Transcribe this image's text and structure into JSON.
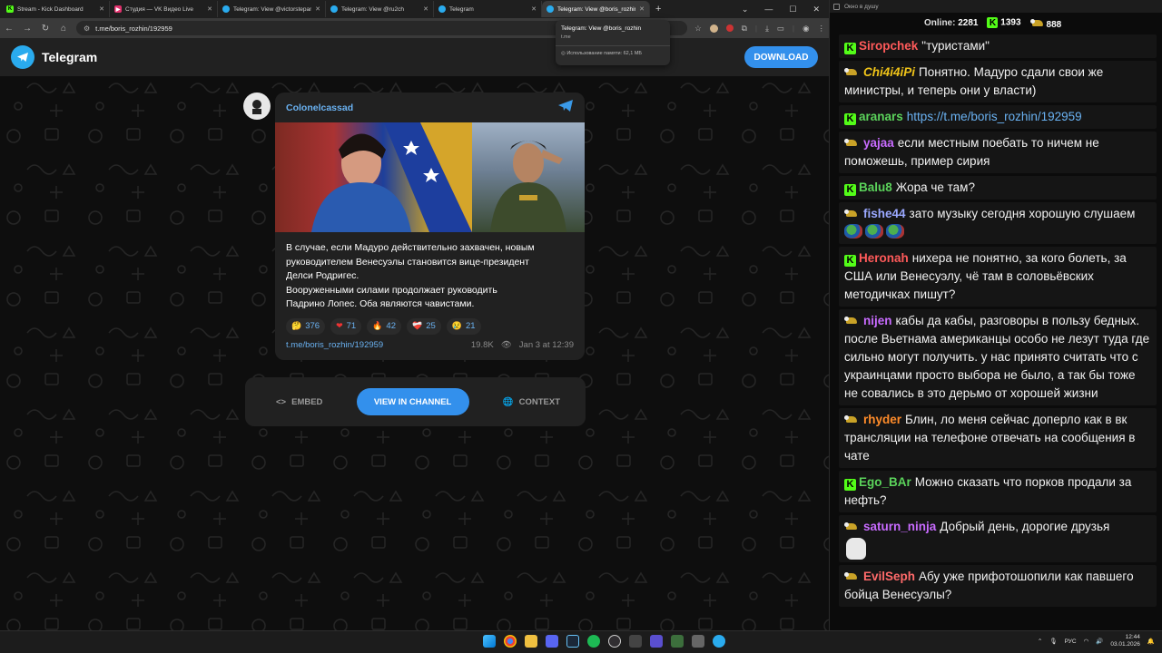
{
  "browser": {
    "tabs": [
      {
        "title": "Stream - Kick Dashboard",
        "color": "#53fc18",
        "glyph": "K"
      },
      {
        "title": "Студия — VK Видео Live",
        "color": "#e1306c",
        "glyph": "▶"
      },
      {
        "title": "Telegram: View @victorstepan",
        "color": "#2aabee",
        "glyph": ""
      },
      {
        "title": "Telegram: View @ru2ch",
        "color": "#2aabee",
        "glyph": ""
      },
      {
        "title": "Telegram",
        "color": "#2aabee",
        "glyph": ""
      },
      {
        "title": "Telegram: View @boris_rozhin",
        "color": "#2aabee",
        "glyph": ""
      }
    ],
    "url": "t.me/boris_rozhin/192959",
    "tooltip": {
      "title": "Telegram: View @boris_rozhin",
      "domain": "t.me",
      "memory": "Использование памяти: 62,1 МБ"
    }
  },
  "telegram": {
    "brand": "Telegram",
    "download_label": "DOWNLOAD",
    "post": {
      "channel": "Colonelcassad",
      "text_lines": [
        "В случае, если Мадуро действительно захвачен, новым",
        "руководителем Венесуэлы становится вице-президент",
        "Делси Родригес.",
        "Вооруженными силами продолжает руководить",
        "Падрино Лопес. Оба являются чавистами."
      ],
      "reactions": [
        {
          "emoji": "🤔",
          "count": "376"
        },
        {
          "emoji": "❤",
          "count": "71"
        },
        {
          "emoji": "🔥",
          "count": "42"
        },
        {
          "emoji": "❤‍🩹",
          "count": "25"
        },
        {
          "emoji": "😢",
          "count": "21"
        }
      ],
      "link": "t.me/boris_rozhin/192959",
      "views": "19.8K",
      "date": "Jan 3 at 12:39"
    },
    "actions": {
      "embed": "EMBED",
      "view": "VIEW IN CHANNEL",
      "context": "CONTEXT"
    }
  },
  "chat": {
    "window_title": "Окно в душу",
    "online_label": "Online:",
    "online_count": "2281",
    "kick_count": "1393",
    "vk_count": "888",
    "messages": [
      {
        "badge": "kick",
        "user": "Siropchek",
        "color": "#ff5a5a",
        "text": "\"туристами\""
      },
      {
        "badge": "vk",
        "user": "Chi4i4iPi",
        "color": "#f0c419",
        "text": "Понятно. Мадуро сдали свои же министры, и теперь они у власти)"
      },
      {
        "badge": "kick",
        "user": "aranars",
        "color": "#5bd35b",
        "text": "",
        "link": "https://t.me/boris_rozhin/192959"
      },
      {
        "badge": "vk",
        "user": "yajaa",
        "color": "#c86bff",
        "text": "если местным поебать то ничем не поможешь, пример сирия"
      },
      {
        "badge": "kick",
        "user": "Balu8",
        "color": "#5bd35b",
        "text": "Жора че там?"
      },
      {
        "badge": "vk",
        "user": "fishe44",
        "color": "#9aa8ff",
        "text": "зато музыку сегодня хорошую слушаем",
        "emotes": 3
      },
      {
        "badge": "kick",
        "user": "Heronah",
        "color": "#ff5a5a",
        "text": "нихера не понятно, за кого болеть, за США или Венесуэлу, чё там в соловьёвских методичках пишут?"
      },
      {
        "badge": "vk",
        "user": "nijen",
        "color": "#c86bff",
        "text": "кабы да кабы, разговоры в пользу бедных. после Вьетнама американцы особо не лезут туда где сильно могут получить. у нас принято считать что с украинцами просто выбора не было, а так бы тоже не совались в это дерьмо от хорошей жизни"
      },
      {
        "badge": "vk",
        "user": "rhyder",
        "color": "#ff8c2a",
        "text": "Блин, ло меня сейчас доперло как в вк трансляции на телефоне отвечать на сообщения в чате"
      },
      {
        "badge": "kick",
        "user": "Ego_BAr",
        "color": "#5bd35b",
        "text": "Можно сказать что порков продали за нефть?"
      },
      {
        "badge": "vk",
        "user": "saturn_ninja",
        "color": "#c86bff",
        "text": "Добрый день, дорогие друзья",
        "cat": true
      },
      {
        "badge": "vk",
        "user": "EvilSeph",
        "color": "#ff6a6a",
        "text": "Абу уже прифотошопили как павшего бойца Венесуэлы?"
      }
    ]
  },
  "taskbar": {
    "lang": "РУС",
    "time": "12:44",
    "date": "03.01.2026"
  }
}
